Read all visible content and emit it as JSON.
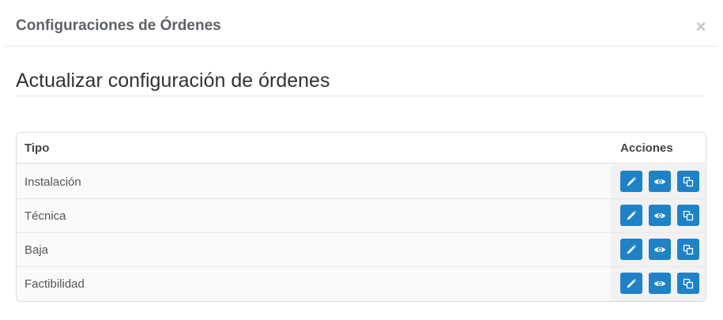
{
  "modal": {
    "title": "Configuraciones de Órdenes",
    "close_symbol": "×"
  },
  "section": {
    "title": "Actualizar configuración de órdenes"
  },
  "table": {
    "headers": {
      "tipo": "Tipo",
      "acciones": "Acciones"
    },
    "rows": [
      {
        "tipo": "Instalación"
      },
      {
        "tipo": "Técnica"
      },
      {
        "tipo": "Baja"
      },
      {
        "tipo": "Factibilidad"
      }
    ],
    "action_icons": [
      "pencil-icon",
      "eye-icon",
      "copy-icon"
    ]
  },
  "colors": {
    "accent": "#1f82c6",
    "title": "#5d6166",
    "border": "#dcdcdc"
  }
}
